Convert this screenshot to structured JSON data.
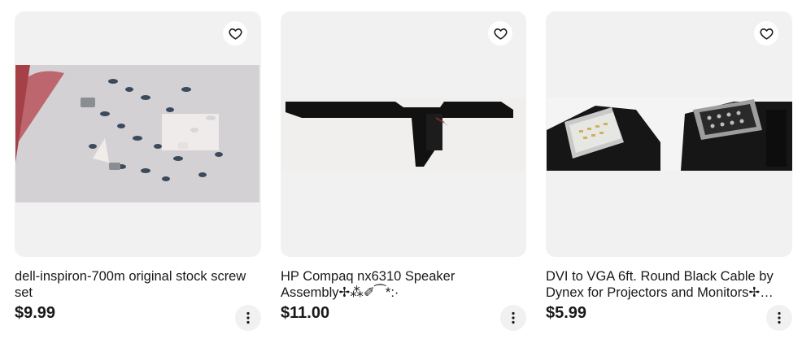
{
  "listings": [
    {
      "title": "dell-inspiron-700m original stock screw set",
      "price": "$9.99",
      "image_icon": "screw-set-photo"
    },
    {
      "title": "HP Compaq nx6310 Speaker Assembly✢⁂✐⁀*:·",
      "price": "$11.00",
      "image_icon": "speaker-assembly-photo"
    },
    {
      "title": "DVI to VGA 6ft. Round Black Cable by Dynex for Projectors and Monitors✢…",
      "price": "$5.99",
      "image_icon": "cable-photo"
    }
  ],
  "icons": {
    "favorite": "heart-icon",
    "more": "more-vertical-icon"
  }
}
